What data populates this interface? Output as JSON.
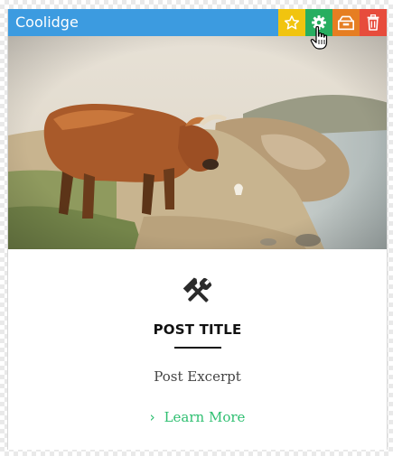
{
  "header": {
    "title": "Coolidge",
    "actions": [
      {
        "name": "favorite",
        "icon": "star-icon",
        "color": "#f1c40f"
      },
      {
        "name": "settings",
        "icon": "gear-icon",
        "color": "#27ae60"
      },
      {
        "name": "save-template",
        "icon": "archive-box-icon",
        "color": "#e67e22"
      },
      {
        "name": "delete",
        "icon": "trash-icon",
        "color": "#e74c3c"
      }
    ]
  },
  "hero": {
    "icon": "photo-highland-cow"
  },
  "post": {
    "icon": "hammer-wrench-icon",
    "title": "POST TITLE",
    "excerpt": "Post Excerpt",
    "link_label": "Learn More",
    "link_icon": "chevron-right-icon",
    "link_color": "#2fbf71"
  },
  "colors": {
    "header_bg": "#3c9be0"
  }
}
